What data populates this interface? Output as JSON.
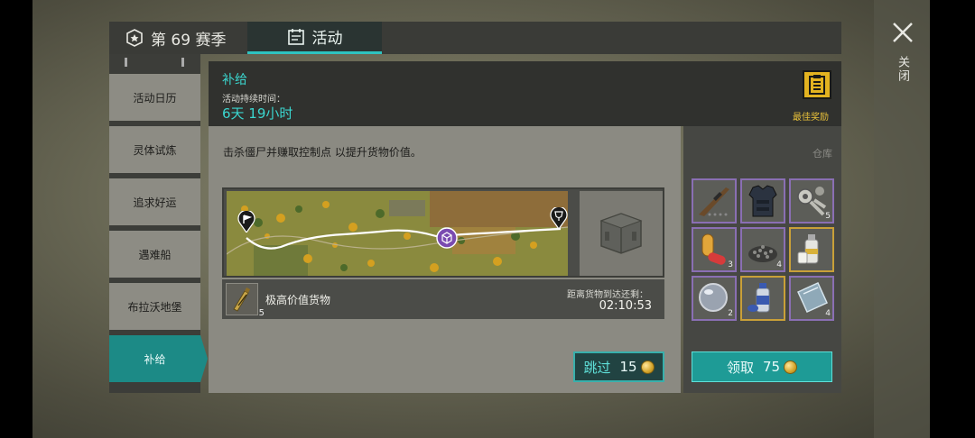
{
  "tabs": {
    "season": "第 69 赛季",
    "activity": "活动"
  },
  "sidebar": {
    "items": [
      {
        "label": "活动日历"
      },
      {
        "label": "灵体试炼"
      },
      {
        "label": "追求好运"
      },
      {
        "label": "遇难船"
      },
      {
        "label": "布拉沃地堡"
      },
      {
        "label": "补给"
      }
    ],
    "active_index": 5
  },
  "header": {
    "title": "补给",
    "duration_label": "活动持续时间：",
    "duration_value": "6天 19小时",
    "best_reward": "最佳奖励"
  },
  "content": {
    "description": "击杀僵尸并赚取控制点 以提升货物价值。",
    "cargo_count": "5",
    "cargo_name": "极高价值货物",
    "distance_label": "距离货物到达还剩：",
    "distance_time": "02:10:53",
    "skip_label": "跳过",
    "skip_cost": "15"
  },
  "warehouse": {
    "title": "仓库",
    "items": [
      {
        "name": "rifle",
        "count": "",
        "rarity": "purple"
      },
      {
        "name": "body-armor",
        "count": "",
        "rarity": "purple"
      },
      {
        "name": "mechanical-parts",
        "count": "5",
        "rarity": "purple"
      },
      {
        "name": "pills",
        "count": "3",
        "rarity": "purple"
      },
      {
        "name": "gravel",
        "count": "4",
        "rarity": "purple"
      },
      {
        "name": "spray-can",
        "count": "",
        "rarity": "gold"
      },
      {
        "name": "lens",
        "count": "2",
        "rarity": "purple"
      },
      {
        "name": "aerosol-can",
        "count": "",
        "rarity": "gold"
      },
      {
        "name": "glass-plate",
        "count": "4",
        "rarity": "purple"
      }
    ],
    "claim_label": "领取",
    "claim_cost": "75"
  },
  "close_label": "关闭",
  "colors": {
    "accent": "#3bd6cf",
    "gold": "#e3b320",
    "purple_rarity": "#8a6fb3"
  }
}
